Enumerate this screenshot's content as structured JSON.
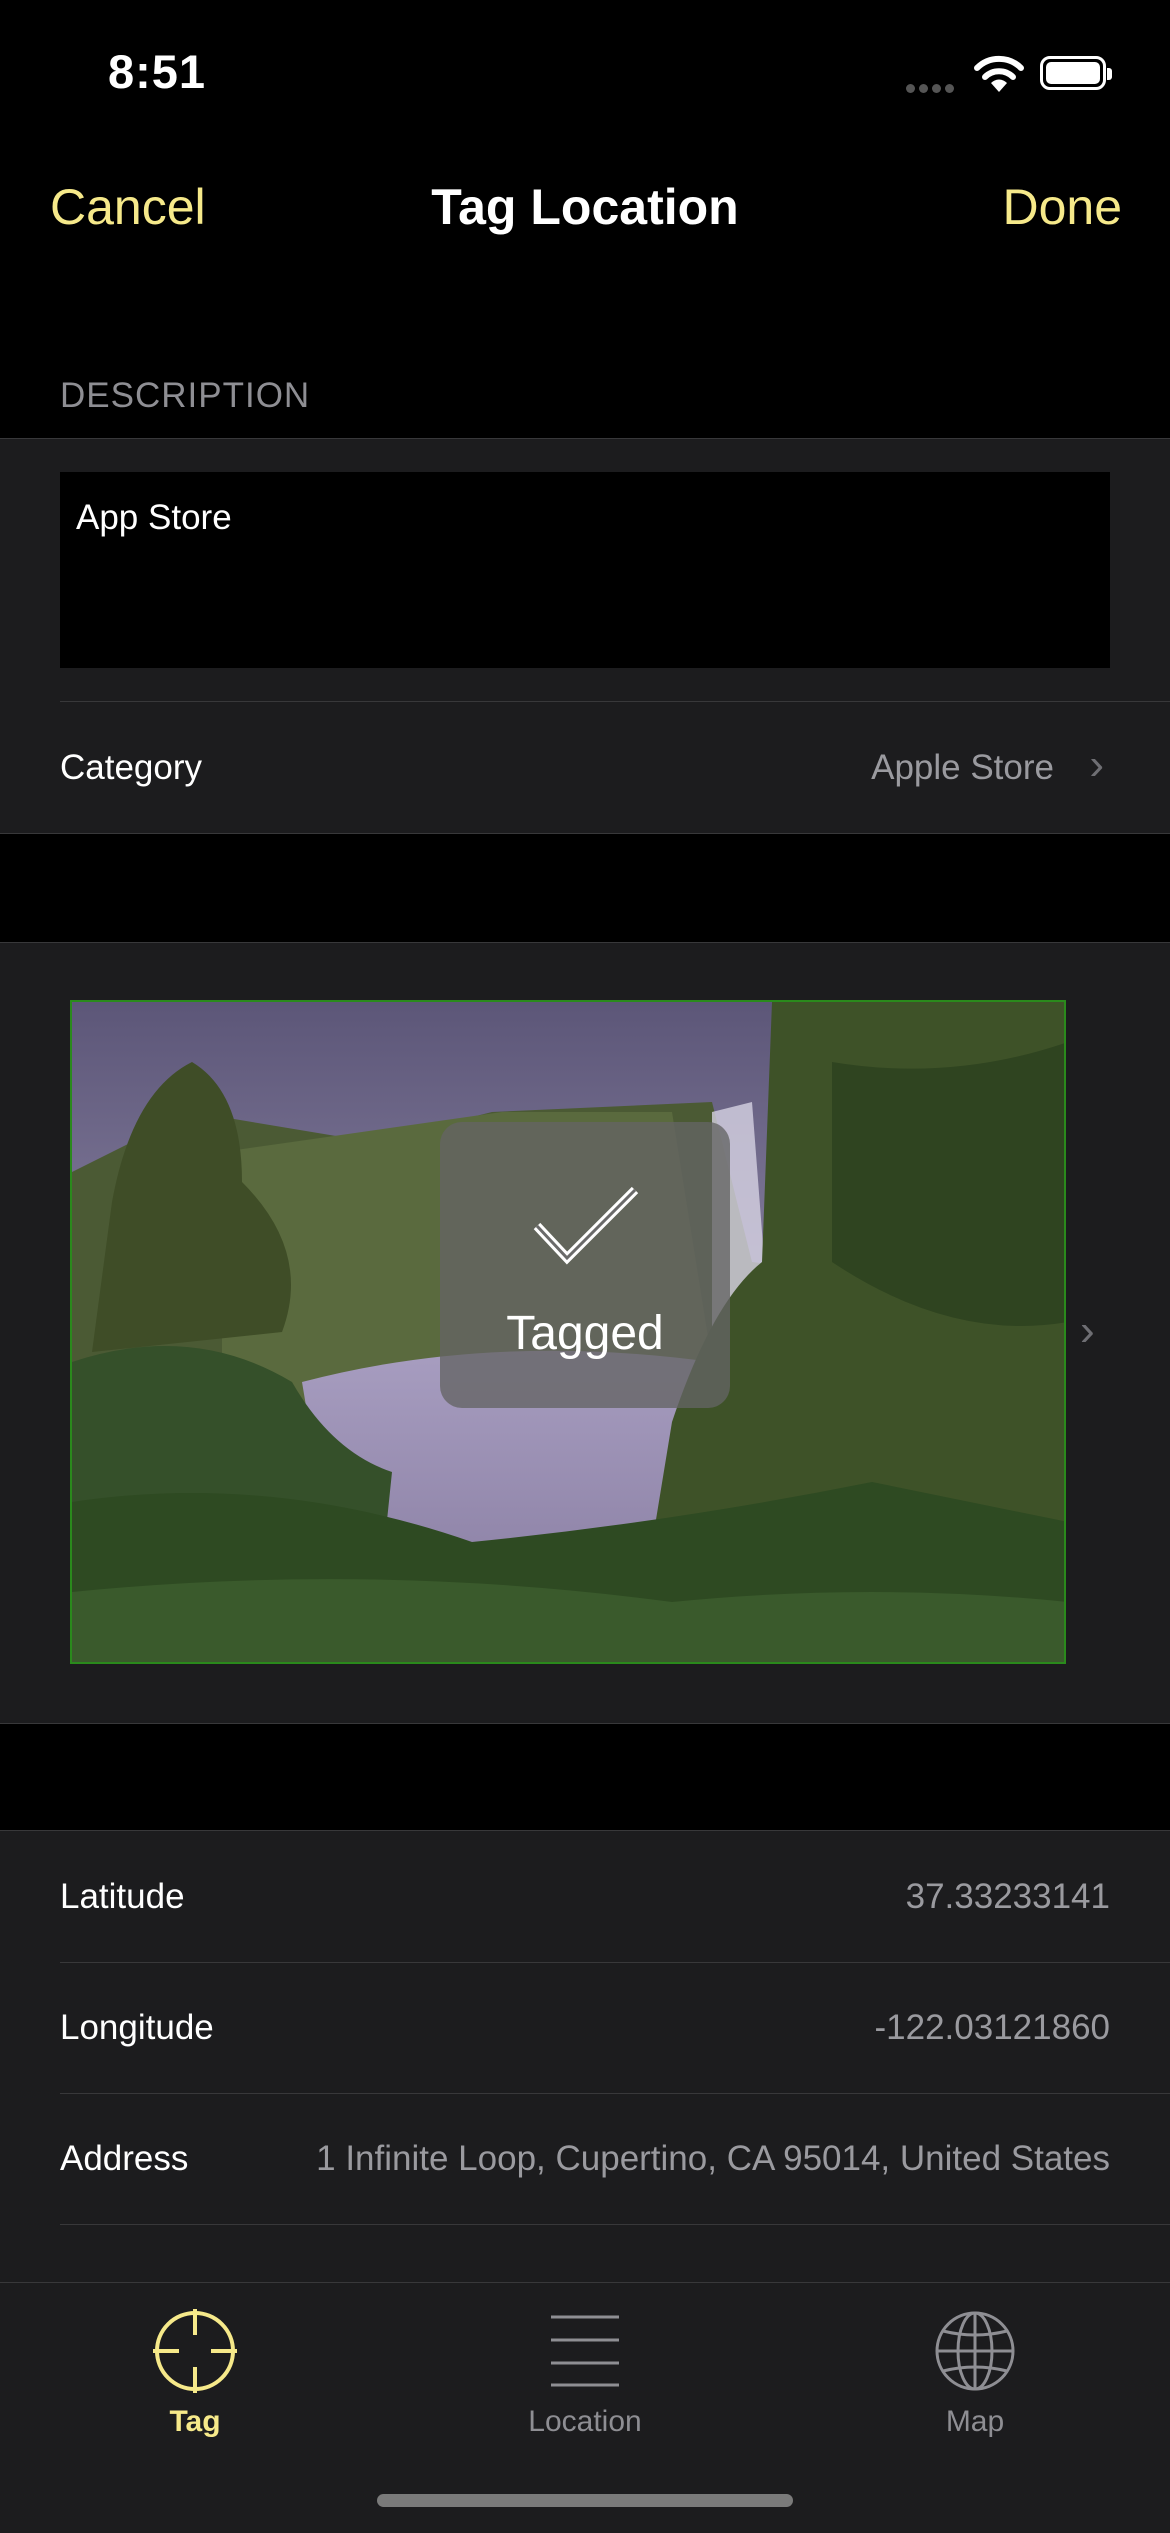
{
  "status_bar": {
    "time": "8:51"
  },
  "nav": {
    "cancel": "Cancel",
    "title": "Tag Location",
    "done": "Done"
  },
  "description": {
    "header": "DESCRIPTION",
    "text": "App Store",
    "category_label": "Category",
    "category_value": "Apple Store"
  },
  "photo": {
    "hud_text": "Tagged"
  },
  "details": {
    "latitude_label": "Latitude",
    "latitude_value": "37.33233141",
    "longitude_label": "Longitude",
    "longitude_value": "-122.03121860",
    "address_label": "Address",
    "address_value": "1 Infinite Loop, Cupertino, CA 95014, United States"
  },
  "tabbar": {
    "items": [
      {
        "label": "Tag",
        "icon": "crosshair-icon",
        "selected": true
      },
      {
        "label": "Location",
        "icon": "list-icon",
        "selected": false
      },
      {
        "label": "Map",
        "icon": "globe-icon",
        "selected": false
      }
    ]
  },
  "colors": {
    "accent": "#f6e98a",
    "background": "#000000",
    "cell": "#1c1c1e",
    "secondary_text": "#9a9a9f"
  }
}
